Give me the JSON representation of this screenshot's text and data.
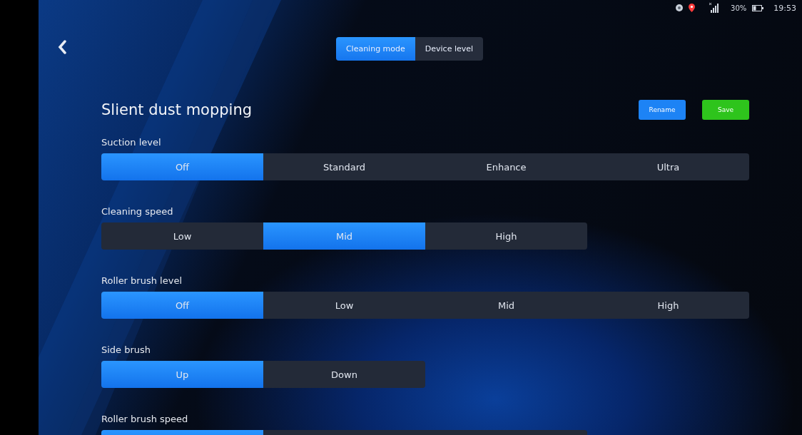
{
  "status_bar": {
    "battery": "30%",
    "time": "19:53"
  },
  "tabs": [
    {
      "label": "Cleaning mode",
      "selected": true
    },
    {
      "label": "Device level",
      "selected": false
    }
  ],
  "title": "Slient dust mopping",
  "buttons": [
    {
      "label": "Rename",
      "kind": "primary"
    },
    {
      "label": "Save",
      "kind": "success"
    }
  ],
  "settings": [
    {
      "label": "Suction level",
      "options": [
        {
          "label": "Off",
          "selected": true
        },
        {
          "label": "Standard",
          "selected": false
        },
        {
          "label": "Enhance",
          "selected": false
        },
        {
          "label": "Ultra",
          "selected": false
        }
      ]
    },
    {
      "label": "Cleaning speed",
      "options": [
        {
          "label": "Low",
          "selected": false
        },
        {
          "label": "Mid",
          "selected": true
        },
        {
          "label": "High",
          "selected": false
        }
      ]
    },
    {
      "label": "Roller brush level",
      "options": [
        {
          "label": "Off",
          "selected": true
        },
        {
          "label": "Low",
          "selected": false
        },
        {
          "label": "Mid",
          "selected": false
        },
        {
          "label": "High",
          "selected": false
        }
      ]
    },
    {
      "label": "Side brush",
      "options": [
        {
          "label": "Up",
          "selected": true
        },
        {
          "label": "Down",
          "selected": false
        }
      ]
    },
    {
      "label": "Roller brush speed",
      "options": [
        {
          "selected": true
        },
        {
          "selected": false
        },
        {
          "selected": false
        }
      ]
    }
  ]
}
